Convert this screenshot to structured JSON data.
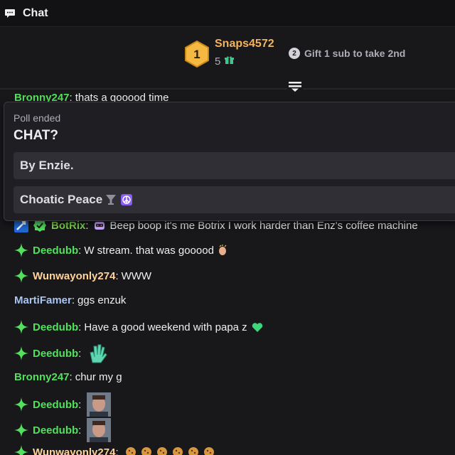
{
  "header": {
    "title": "Chat",
    "icon": "chat-bubble-icon"
  },
  "leaderboard": {
    "rank": "1",
    "top_user": "Snaps4572",
    "gift_count": "5",
    "place_badge": "2",
    "cta": "Gift 1 sub to take 2nd"
  },
  "poll": {
    "status": "Poll ended",
    "question": "CHAT?",
    "options": [
      {
        "label": "By Enzie."
      },
      {
        "label": "Choatic Peace"
      }
    ]
  },
  "chat": {
    "partial_top": {
      "user": "Bronny247",
      "text": "thats a gooood time"
    },
    "messages": [
      {
        "user": "BotRix",
        "color": "#7ddc4b",
        "text": "Beep boop it's me Botrix I work harder than Enz's coffee machine"
      },
      {
        "user": "Deedubb",
        "color": "#53e05c",
        "text": "W stream. that was gooood"
      },
      {
        "user": "Wunwayonly274",
        "color": "#ffd39a",
        "text": "WWW"
      },
      {
        "user": "MartiFamer",
        "color": "#a9c5f0",
        "text": "ggs enzuk"
      },
      {
        "user": "Deedubb",
        "color": "#53e05c",
        "text": "Have a good weekend with papa z"
      },
      {
        "user": "Deedubb",
        "color": "#53e05c",
        "text": ""
      },
      {
        "user": "Bronny247",
        "color": "#53e05c",
        "text": "chur my g"
      },
      {
        "user": "Deedubb",
        "color": "#53e05c",
        "text": ""
      },
      {
        "user": "Deedubb",
        "color": "#53e05c",
        "text": ""
      },
      {
        "user": "Wunwayonly274",
        "color": "#ffd39a",
        "text": ""
      }
    ]
  },
  "colors": {
    "background": "#18181b",
    "accent_gold": "#f4b35c",
    "green": "#53e05c",
    "poll_bg": "#1f1f23"
  }
}
